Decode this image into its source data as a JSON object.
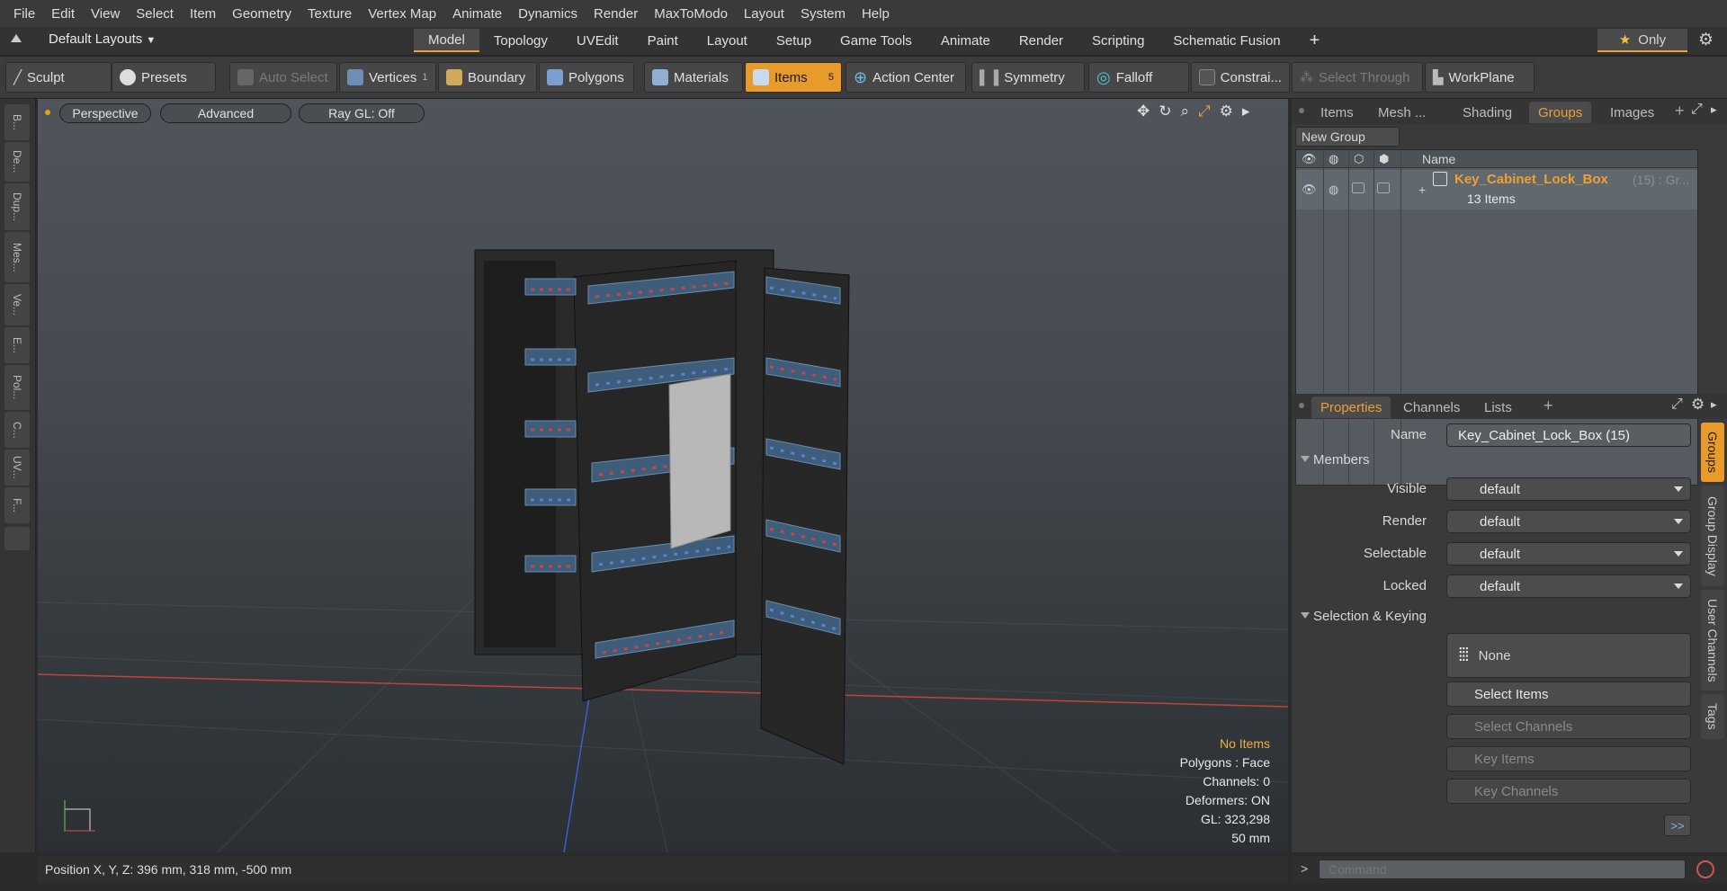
{
  "menu": [
    "File",
    "Edit",
    "View",
    "Select",
    "Item",
    "Geometry",
    "Texture",
    "Vertex Map",
    "Animate",
    "Dynamics",
    "Render",
    "MaxToModo",
    "Layout",
    "System",
    "Help"
  ],
  "layout_selector": "Default Layouts",
  "layout_tabs": [
    "Model",
    "Topology",
    "UVEdit",
    "Paint",
    "Layout",
    "Setup",
    "Game Tools",
    "Animate",
    "Render",
    "Scripting",
    "Schematic Fusion"
  ],
  "active_layout_tab": "Model",
  "only_label": "Only",
  "toolbar": {
    "sculpt": "Sculpt",
    "presets": "Presets",
    "auto_select": "Auto Select",
    "vertices": "Vertices",
    "vertices_count": "1",
    "boundary": "Boundary",
    "polygons": "Polygons",
    "materials": "Materials",
    "items": "Items",
    "items_count": "5",
    "action_center": "Action Center",
    "symmetry": "Symmetry",
    "falloff": "Falloff",
    "constraints": "Constrai...",
    "select_through": "Select Through",
    "workplane": "WorkPlane"
  },
  "left_tabs": [
    "B...",
    "De...",
    "Dup...",
    "Mes...",
    "Ve...",
    "E...",
    "Pol...",
    "C...",
    "UV...",
    "F..."
  ],
  "viewport": {
    "view": "Perspective",
    "shading": "Advanced",
    "raygl": "Ray GL: Off",
    "stats": {
      "selection": "No Items",
      "polygons": "Polygons : Face",
      "channels": "Channels: 0",
      "deformers": "Deformers: ON",
      "gl": "GL: 323,298",
      "scale": "50 mm"
    }
  },
  "status": {
    "position": "Position X, Y, Z:  396 mm, 318 mm, -500 mm"
  },
  "top_panel": {
    "tabs": [
      "Items",
      "Mesh ...",
      "Shading",
      "Groups",
      "Images"
    ],
    "active": "Groups",
    "new_group": "New Group",
    "col_name": "Name",
    "group": {
      "name": "Key_Cabinet_Lock_Box",
      "suffix": "(15) : Gr...",
      "count": "13 Items"
    }
  },
  "props_panel": {
    "tabs": [
      "Properties",
      "Channels",
      "Lists"
    ],
    "active": "Properties",
    "name_label": "Name",
    "name_value": "Key_Cabinet_Lock_Box (15)",
    "members": "Members",
    "visible": {
      "label": "Visible",
      "value": "default"
    },
    "render": {
      "label": "Render",
      "value": "default"
    },
    "selectable": {
      "label": "Selectable",
      "value": "default"
    },
    "locked": {
      "label": "Locked",
      "value": "default"
    },
    "selection_keying": "Selection & Keying",
    "none": "None",
    "select_items": "Select Items",
    "select_channels": "Select Channels",
    "key_items": "Key Items",
    "key_channels": "Key Channels",
    "more": ">>"
  },
  "right_tabs": [
    "Groups",
    "Group Display",
    "User Channels",
    "Tags"
  ],
  "command": {
    "placeholder": "Command"
  },
  "colors": {
    "accent": "#e89a2a",
    "group_name": "#f0a030"
  }
}
